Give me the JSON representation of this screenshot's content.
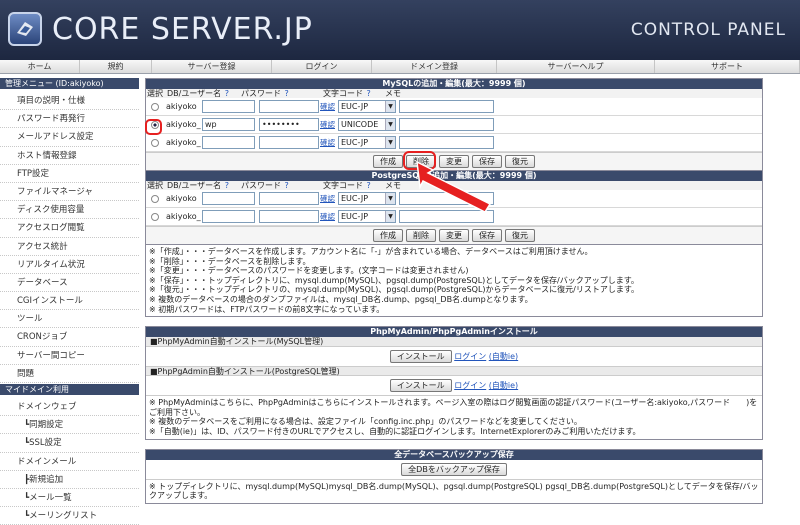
{
  "header": {
    "brand": "CORE SERVER.JP",
    "panel": "CONTROL PANEL"
  },
  "nav": [
    {
      "label": "ホーム",
      "w": 80
    },
    {
      "label": "規約",
      "w": 72
    },
    {
      "label": "サーバー登録",
      "w": 120
    },
    {
      "label": "ログイン",
      "w": 100
    },
    {
      "label": "ドメイン登録",
      "w": 125
    },
    {
      "label": "サーバーヘルプ",
      "w": 158
    },
    {
      "label": "サポート",
      "w": 145
    }
  ],
  "sidebar": {
    "head1": "管理メニュー (ID:akiyoko)",
    "items1": [
      "項目の説明・仕様",
      "パスワード再発行",
      "メールアドレス設定",
      "ホスト情報登録",
      "FTP設定",
      "ファイルマネージャ",
      "ディスク使用容量",
      "アクセスログ閲覧",
      "アクセス統計",
      "リアルタイム状況",
      "データベース",
      "CGIインストール",
      "ツール",
      "CRONジョブ",
      "サーバー間コピー",
      "問題"
    ],
    "head2": "マイドメイン利用",
    "items2": [
      "ドメインウェブ",
      "┗同期設定",
      "┗SSL設定",
      "ドメインメール",
      "┣新規追加",
      "┗メール一覧",
      "┗メーリングリスト"
    ]
  },
  "mysql": {
    "title": "MySQLの追加・編集(最大：9999 個)",
    "cols": {
      "select": "選択",
      "db": "DB/ユーザー名",
      "pw": "パスワード",
      "charset": "文字コード",
      "memo": "メモ",
      "q": "?"
    },
    "rows": [
      {
        "prefix": "akiyoko",
        "value": "",
        "pw": "",
        "charset": "EUC-JP",
        "selected": false
      },
      {
        "prefix": "akiyoko_",
        "value": "wp",
        "pw": "••••••••",
        "charset": "UNICODE",
        "selected": true
      },
      {
        "prefix": "akiyoko_",
        "value": "",
        "pw": "",
        "charset": "EUC-JP",
        "selected": false
      }
    ],
    "confirm": "確認"
  },
  "postgres": {
    "title": "PostgreSQLの追加・編集(最大：9999 個)",
    "rows": [
      {
        "prefix": "akiyoko",
        "charset": "EUC-JP"
      },
      {
        "prefix": "akiyoko_",
        "charset": "EUC-JP"
      }
    ]
  },
  "buttons": {
    "create": "作成",
    "delete": "削除",
    "change": "変更",
    "save": "保存",
    "restore": "復元"
  },
  "notes": [
    "※「作成」・・・データベースを作成します。アカウント名に「-」が含まれている場合、データベースはご利用頂けません。",
    "※「削除」・・・データベースを削除します。",
    "※「変更」・・・データベースのパスワードを変更します。(文字コードは変更されません)",
    "※「保存」・・・トップディレクトリに、mysql.dump(MySQL)、pgsql.dump(PostgreSQL)としてデータを保存/バックアップします。",
    "※「復元」・・・トップディレクトリの、mysql.dump(MySQL)、pgsql.dump(PostgreSQL)からデータベースに復元/リストアします。",
    "※ 複数のデータベースの場合のダンプファイルは、mysql_DB名.dump、pgsql_DB名.dumpとなります。",
    "※ 初期パスワードは、FTPパスワードの前8文字になっています。"
  ],
  "phpadmin": {
    "title": "PhpMyAdmin/PhpPgAdminインストール",
    "mysql_label": "■PhpMyAdmin自動インストール(MySQL管理)",
    "pg_label": "■PhpPgAdmin自動インストール(PostgreSQL管理)",
    "install": "インストール",
    "login": "ログイン",
    "auto": "(自動ie)",
    "notes": [
      "※ PhpMyAdminはこちらに、PhpPgAdminはこちらにインストールされます。ページ入室の際はログ閲覧画面の認証パスワード(ユーザー名:akiyoko,パスワード　　)をご利用下さい。",
      "※ 複数のデータベースをご利用になる場合は、設定ファイル「config.inc.php」のパスワードなどを変更してください。",
      "※「自動(ie)」は、ID、パスワード付きのURLでアクセスし、自動的に認証ログインします。InternetExplorerのみご利用いただけます。"
    ]
  },
  "backup": {
    "title": "全データベースバックアップ保存",
    "button": "全DBをバックアップ保存",
    "note": "※ トップディレクトリに、mysql.dump(MySQL)mysql_DB名.dump(MySQL)、pgsql.dump(PostgreSQL) pgsql_DB名.dump(PostgreSQL)としてデータを保存/バックアップします。"
  },
  "colors": {
    "accent": "#3a4a6b",
    "highlight": "#e62020"
  }
}
